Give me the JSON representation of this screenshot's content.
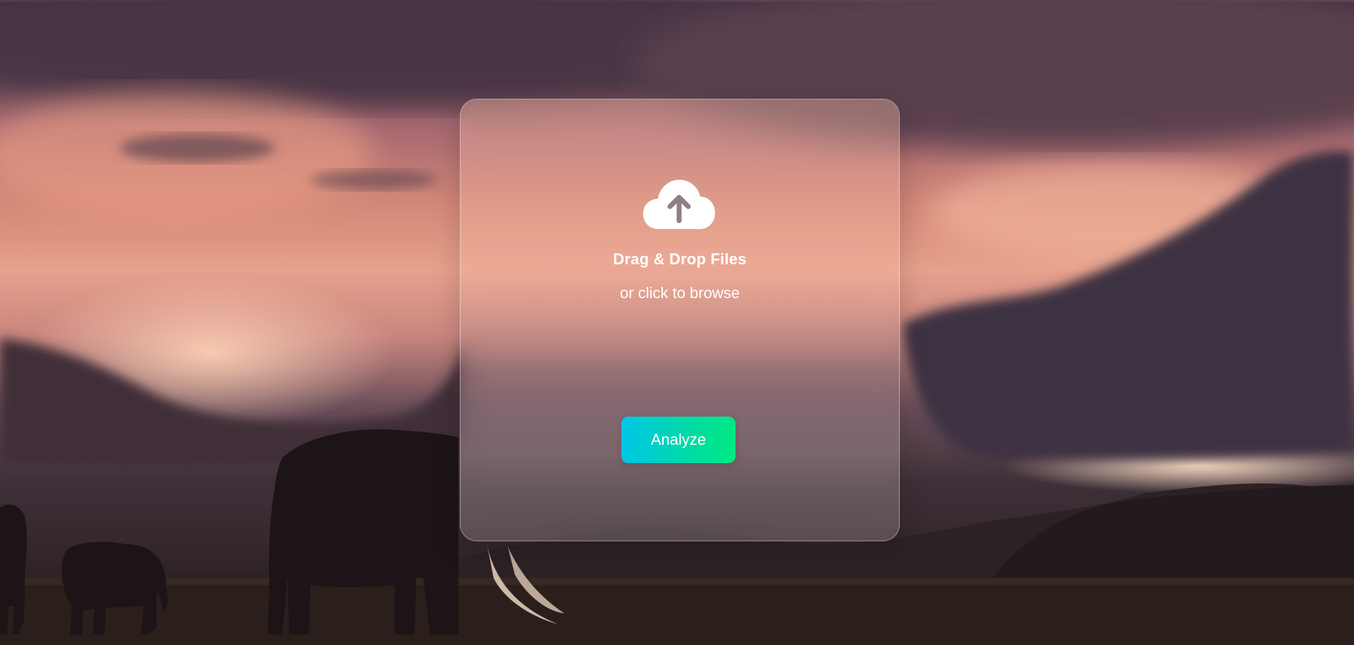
{
  "upload": {
    "icon": "cloud-upload-icon",
    "title": "Drag & Drop Files",
    "subtitle": "or click to browse"
  },
  "actions": {
    "analyze_label": "Analyze"
  },
  "colors": {
    "button_gradient_start": "#00c6e8",
    "button_gradient_end": "#00ea82",
    "text": "#ffffff"
  }
}
